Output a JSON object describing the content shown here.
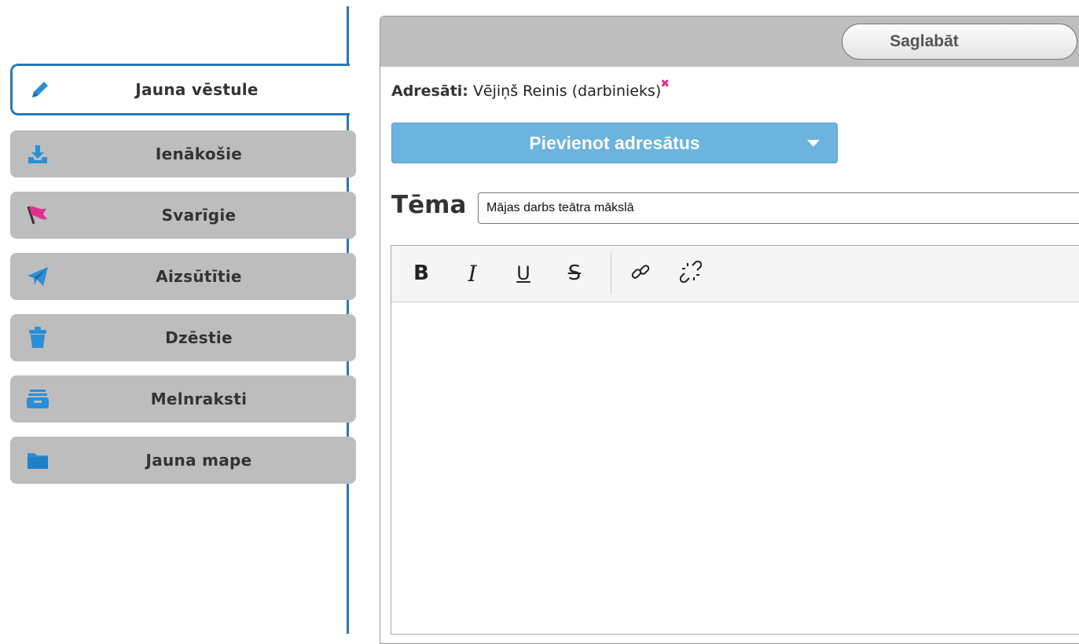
{
  "sidebar": {
    "items": [
      {
        "label": "Jauna vēstule",
        "icon": "pencil-icon",
        "active": true
      },
      {
        "label": "Ienākošie",
        "icon": "inbox-download-icon"
      },
      {
        "label": "Svarīgie",
        "icon": "flag-icon"
      },
      {
        "label": "Aizsūtītie",
        "icon": "paper-plane-icon"
      },
      {
        "label": "Dzēstie",
        "icon": "trash-icon"
      },
      {
        "label": "Melnraksti",
        "icon": "drafts-box-icon"
      },
      {
        "label": "Jauna mape",
        "icon": "folder-icon"
      }
    ]
  },
  "header": {
    "save_label": "Saglabāt"
  },
  "recipients": {
    "label": "Adresāti:",
    "list": [
      "Vējiņš Reinis (darbinieks)"
    ]
  },
  "add_recipients": {
    "label": "Pievienot adresātus"
  },
  "subject": {
    "label": "Tēma",
    "value": "Mājas darbs teātra mākslā"
  },
  "editor": {
    "toolbar": [
      "bold",
      "italic",
      "underline",
      "strikethrough",
      "link",
      "unlink"
    ],
    "toolbar_glyphs": {
      "bold": "B",
      "italic": "I",
      "underline": "U",
      "strikethrough": "S"
    },
    "body": ""
  },
  "colors": {
    "accent": "#2a78b5",
    "nav_bg": "#bdbdbd",
    "button_blue": "#6cb3dd",
    "remove_x": "#e0308c",
    "icon_blue": "#2a8fd6",
    "icon_pink": "#e0308c"
  }
}
